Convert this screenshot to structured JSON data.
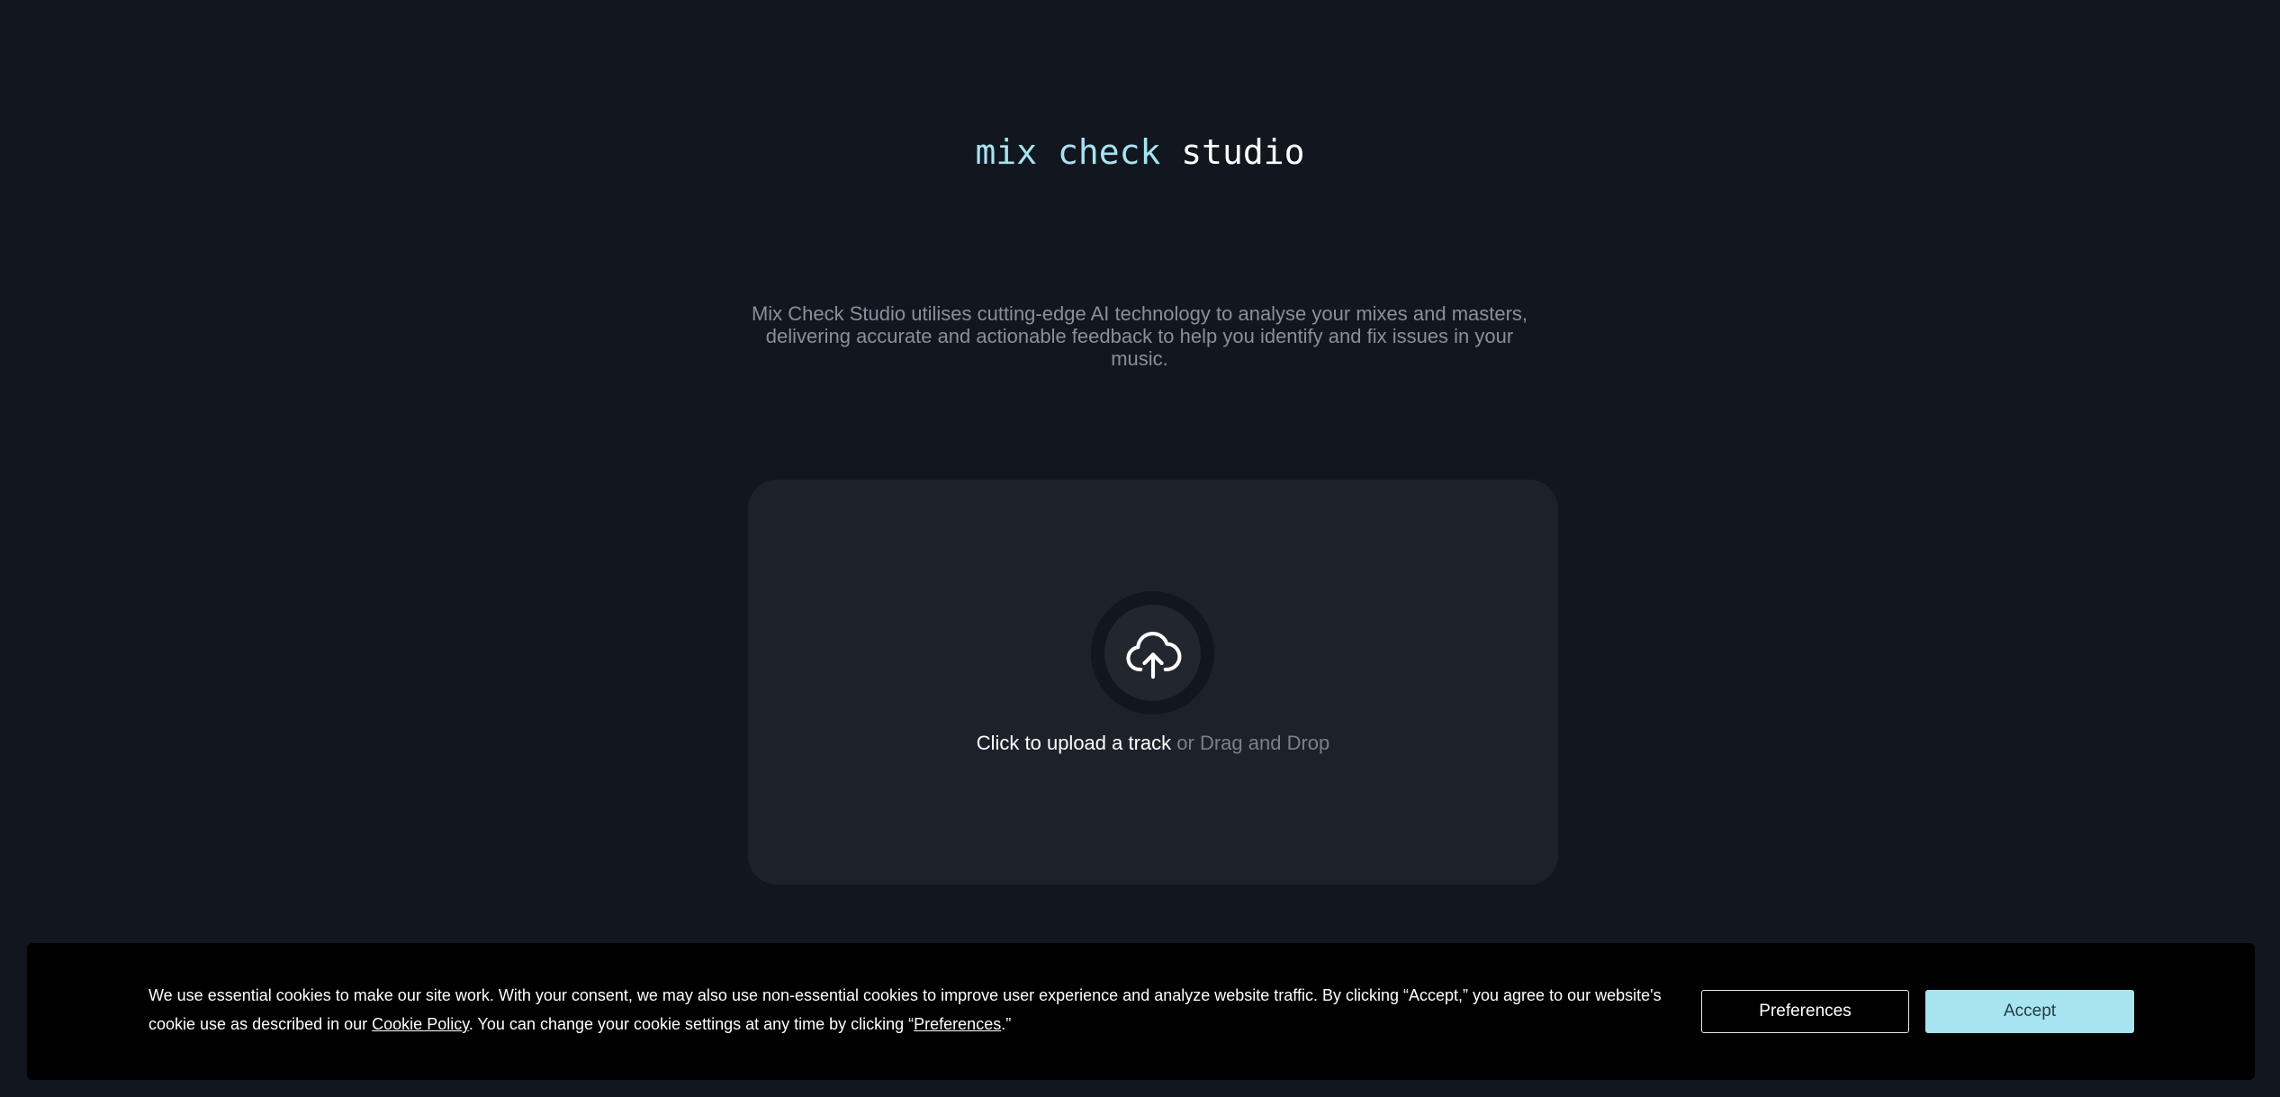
{
  "logo": {
    "accent_text": "mix check",
    "plain_text": "studio"
  },
  "tagline": "Mix Check Studio utilises cutting-edge AI technology to analyse your mixes and masters, delivering accurate and actionable feedback to help you identify and fix issues in your music.",
  "upload": {
    "icon": "cloud-upload-icon",
    "primary_text": "Click to upload a track",
    "secondary_text": "or Drag and Drop"
  },
  "cookie_banner": {
    "text_part1": "We use essential cookies to make our site work. With your consent, we may also use non-essential cookies to improve user experience and analyze website traffic. By clicking “Accept,” you agree to our website's cookie use as described in our ",
    "cookie_policy_link": "Cookie Policy",
    "text_part2": ". You can change your cookie settings at any time by clicking “",
    "preferences_link": "Preferences",
    "text_part3": ".”",
    "preferences_button": "Preferences",
    "accept_button": "Accept"
  },
  "colors": {
    "background": "#12161e",
    "accent": "#a7e3f0",
    "card": "#1d2129",
    "banner": "#000000"
  }
}
